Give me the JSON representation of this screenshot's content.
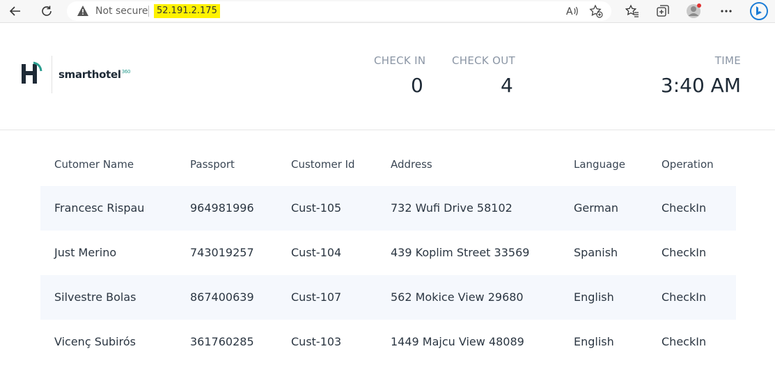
{
  "browser": {
    "security_text": "Not secure",
    "url": "52.191.2.175"
  },
  "header": {
    "logo_text": "smarthotel",
    "logo_superscript": "360",
    "check_in_label": "CHECK IN",
    "check_in_value": "0",
    "check_out_label": "CHECK OUT",
    "check_out_value": "4",
    "time_label": "TIME",
    "time_value": "3:40 AM"
  },
  "table": {
    "columns": [
      "Cutomer Name",
      "Passport",
      "Customer Id",
      "Address",
      "Language",
      "Operation"
    ],
    "rows": [
      [
        "Francesc Rispau",
        "964981996",
        "Cust-105",
        "732 Wufi Drive 58102",
        "German",
        "CheckIn"
      ],
      [
        "Just Merino",
        "743019257",
        "Cust-104",
        "439 Koplim Street 33569",
        "Spanish",
        "CheckIn"
      ],
      [
        "Silvestre Bolas",
        "867400639",
        "Cust-107",
        "562 Mokice View 29680",
        "English",
        "CheckIn"
      ],
      [
        "Vicenç Subirós",
        "361760285",
        "Cust-103",
        "1449 Majcu View 48089",
        "English",
        "CheckIn"
      ]
    ]
  },
  "colors": {
    "brand_teal": "#2a9d8f",
    "brand_dark": "#1e2a36",
    "row_alt": "#f5f8fd",
    "url_highlight": "#fff200"
  }
}
